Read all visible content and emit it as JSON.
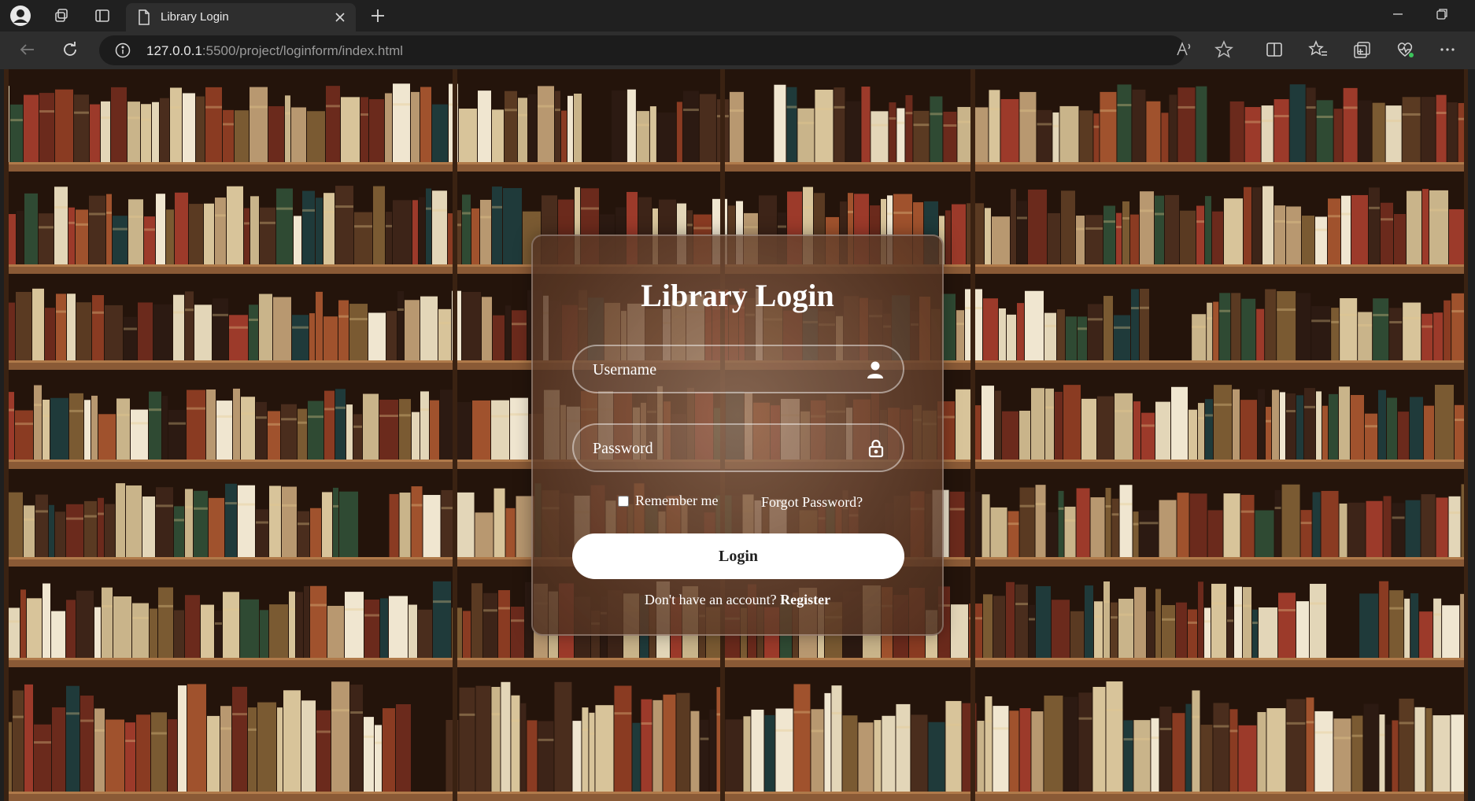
{
  "browser": {
    "tab_title": "Library Login",
    "url_host": "127.0.0.1",
    "url_rest": ":5500/project/loginform/index.html"
  },
  "login": {
    "heading": "Library Login",
    "username_placeholder": "Username",
    "password_placeholder": "Password",
    "remember_label": "Remember me",
    "forgot_label": "Forgot Password?",
    "login_button": "Login",
    "register_prompt": "Don't have an account?",
    "register_link": "Register"
  },
  "icons": {
    "username_field": "user-icon",
    "password_field": "lock-icon"
  },
  "colors": {
    "card_tint": "#8a5a3e",
    "button_bg": "#ffffff",
    "text": "#ffffff"
  }
}
